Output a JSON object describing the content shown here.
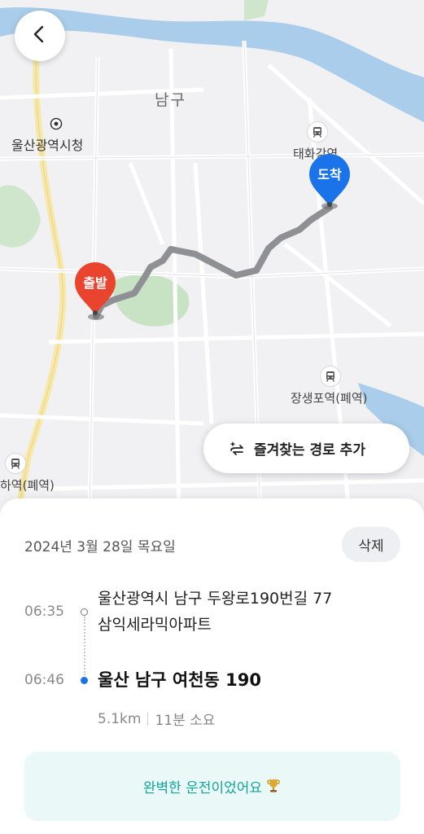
{
  "map": {
    "district": "남구",
    "labels": {
      "city_hall": "울산광역시청",
      "station_taehwa": "태화강역",
      "station_jangsaengpo": "장생포역(폐역)",
      "station_left": "하역(폐역)"
    },
    "start_pin": "출발",
    "end_pin": "도착",
    "colors": {
      "route": "#8f9094",
      "start": "#e9452e",
      "end": "#1a73e8",
      "river": "#a9cdea",
      "park": "#c7e3c4"
    }
  },
  "buttons": {
    "back_icon": "chevron-left-icon",
    "favorite_route": "즐겨찾는 경로 추가",
    "delete": "삭제"
  },
  "trip": {
    "date": "2024년 3월 28일 목요일",
    "start": {
      "time": "06:35",
      "address_line1": "울산광역시 남구 두왕로190번길 77",
      "address_line2": "삼익세라믹아파트"
    },
    "end": {
      "time": "06:46",
      "address": "울산 남구 여천동 190"
    },
    "distance": "5.1km",
    "duration": "11분 소요",
    "message": "완벽한 운전이었어요"
  }
}
